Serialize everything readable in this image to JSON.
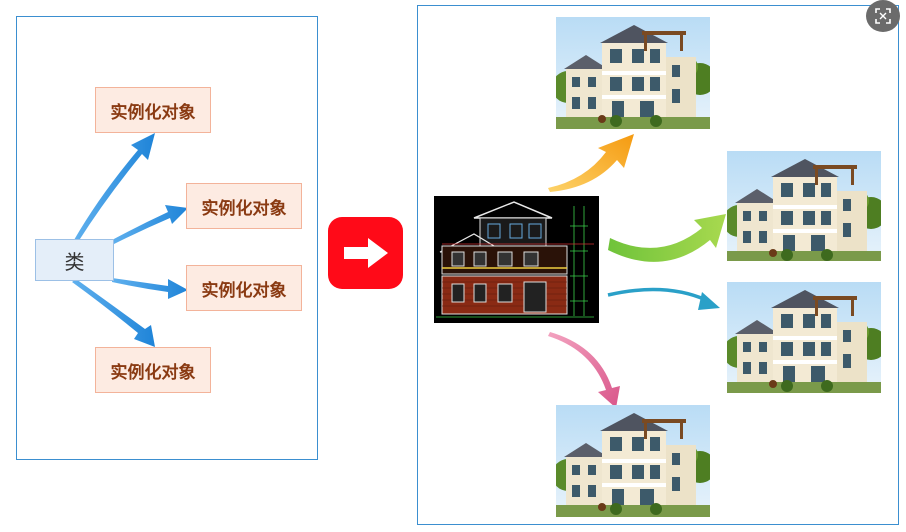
{
  "left_diagram": {
    "class_label": "类",
    "instances": [
      {
        "label": "实例化对象"
      },
      {
        "label": "实例化对象"
      },
      {
        "label": "实例化对象"
      },
      {
        "label": "实例化对象"
      }
    ]
  },
  "middle": {
    "arrow_icon": "right-arrow-icon",
    "button_color": "#ff0a18"
  },
  "right_diagram": {
    "blueprint_icon": "house-blueprint-image",
    "house_icon": "house-photo-image",
    "arrow_colors": [
      "#f7a21b",
      "#8bc53f",
      "#2aa0c8",
      "#e0719a"
    ]
  },
  "corner_icon": "scan-icon",
  "colors": {
    "panel_border": "#3b8fd0",
    "class_fill": "#e4eef9",
    "instance_fill": "#fdebe2",
    "instance_text": "#8a3a12",
    "arrow_blue": "#2f8fdc"
  }
}
